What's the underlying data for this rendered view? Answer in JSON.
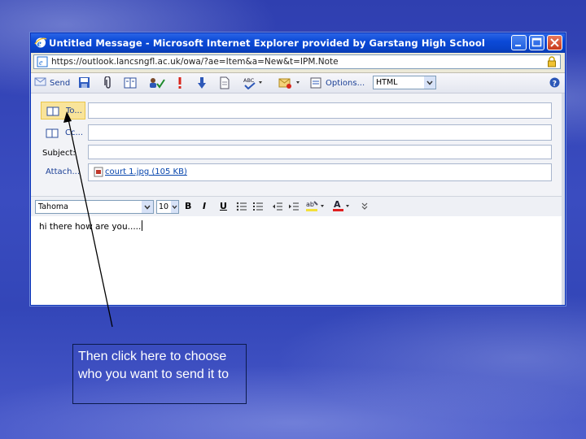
{
  "window": {
    "title": "Untitled Message - Microsoft Internet Explorer provided by Garstang High School",
    "url": "https://outlook.lancsngfl.ac.uk/owa/?ae=Item&a=New&t=IPM.Note"
  },
  "toolbar": {
    "send_label": "Send",
    "options_label": "Options...",
    "format_value": "HTML"
  },
  "header": {
    "to_label": "To...",
    "cc_label": "Cc...",
    "subject_label": "Subject:",
    "attach_label": "Attach...",
    "attachment": "court 1.jpg (105 KB)",
    "to_value": "",
    "cc_value": "",
    "subject_value": ""
  },
  "format_bar": {
    "font": "Tahoma",
    "size": "10",
    "bold": "B",
    "italic": "I",
    "underline": "U"
  },
  "message": {
    "body": "hi there how are you....."
  },
  "callout": {
    "text": "Then click here to choose who you want to send it to"
  },
  "colors": {
    "titlebar": "#0b4ad8",
    "to_highlight": "#f9e49a",
    "link": "#1b3f96"
  }
}
